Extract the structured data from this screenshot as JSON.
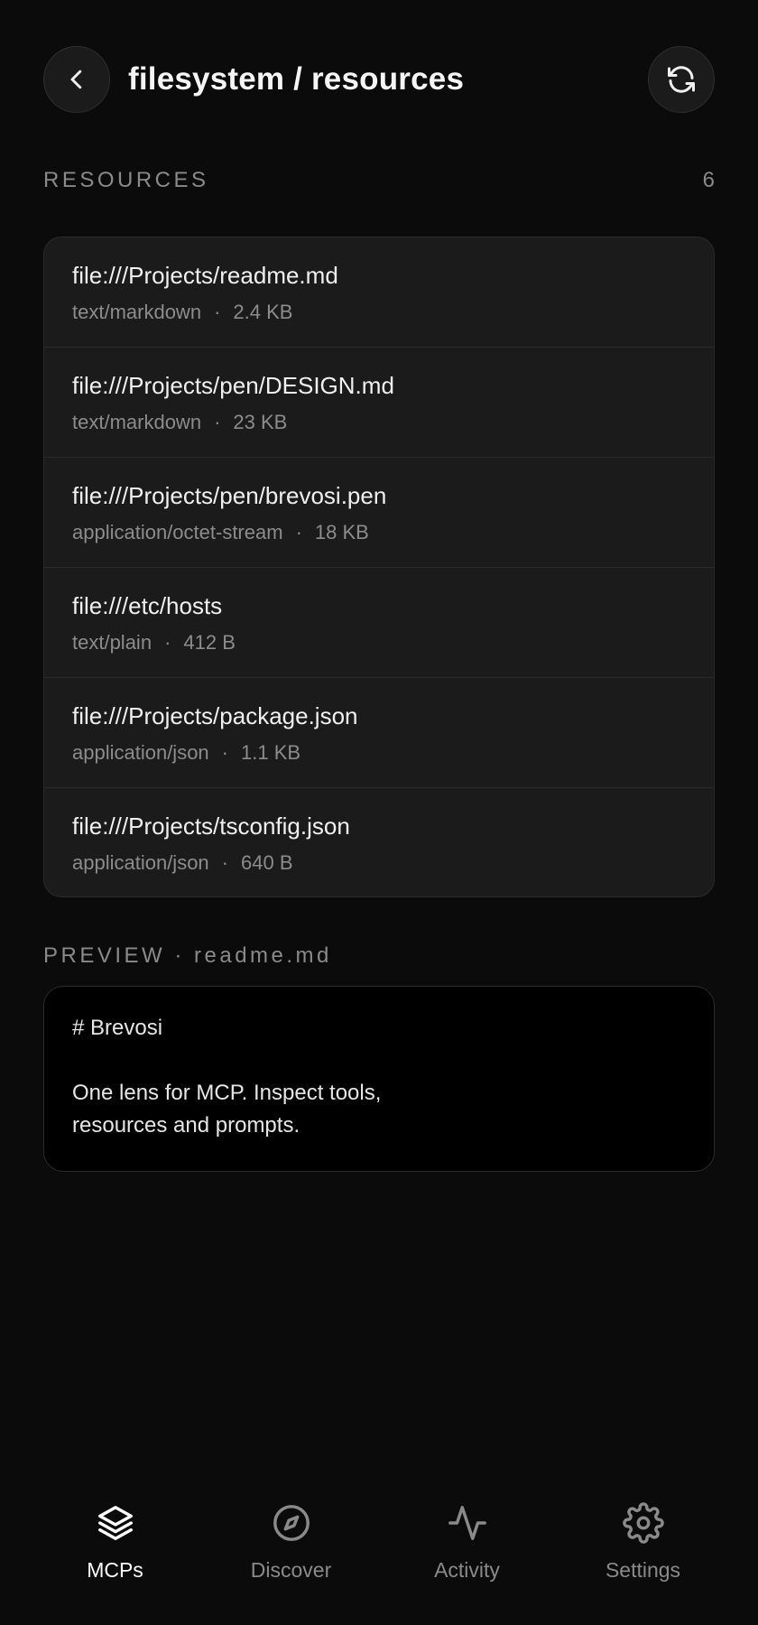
{
  "header": {
    "title": "filesystem / resources",
    "back_icon": "chevron-left-icon",
    "refresh_icon": "refresh-icon"
  },
  "resources": {
    "label": "RESOURCES",
    "count": "6",
    "items": [
      {
        "uri": "file:///Projects/readme.md",
        "type": "text/markdown",
        "sep": "·",
        "size": "2.4 KB"
      },
      {
        "uri": "file:///Projects/pen/DESIGN.md",
        "type": "text/markdown",
        "sep": "·",
        "size": "23 KB"
      },
      {
        "uri": "file:///Projects/pen/brevosi.pen",
        "type": "application/octet-stream",
        "sep": "·",
        "size": "18 KB"
      },
      {
        "uri": "file:///etc/hosts",
        "type": "text/plain",
        "sep": "·",
        "size": "412 B"
      },
      {
        "uri": "file:///Projects/package.json",
        "type": "application/json",
        "sep": "·",
        "size": "1.1 KB"
      },
      {
        "uri": "file:///Projects/tsconfig.json",
        "type": "application/json",
        "sep": "·",
        "size": "640 B"
      }
    ]
  },
  "preview": {
    "label": "PREVIEW · readme.md",
    "lines": [
      "# Brevosi",
      "",
      "One lens for MCP. Inspect tools,",
      "resources and prompts."
    ]
  },
  "nav": {
    "items": [
      {
        "label": "MCPs",
        "icon": "layers-icon",
        "active": true
      },
      {
        "label": "Discover",
        "icon": "compass-icon",
        "active": false
      },
      {
        "label": "Activity",
        "icon": "activity-icon",
        "active": false
      },
      {
        "label": "Settings",
        "icon": "gear-icon",
        "active": false
      }
    ]
  },
  "colors": {
    "background": "#0b0b0b",
    "card": "#1b1b1b",
    "muted_text": "#8a8a8a",
    "active_nav": "#ffffff"
  }
}
